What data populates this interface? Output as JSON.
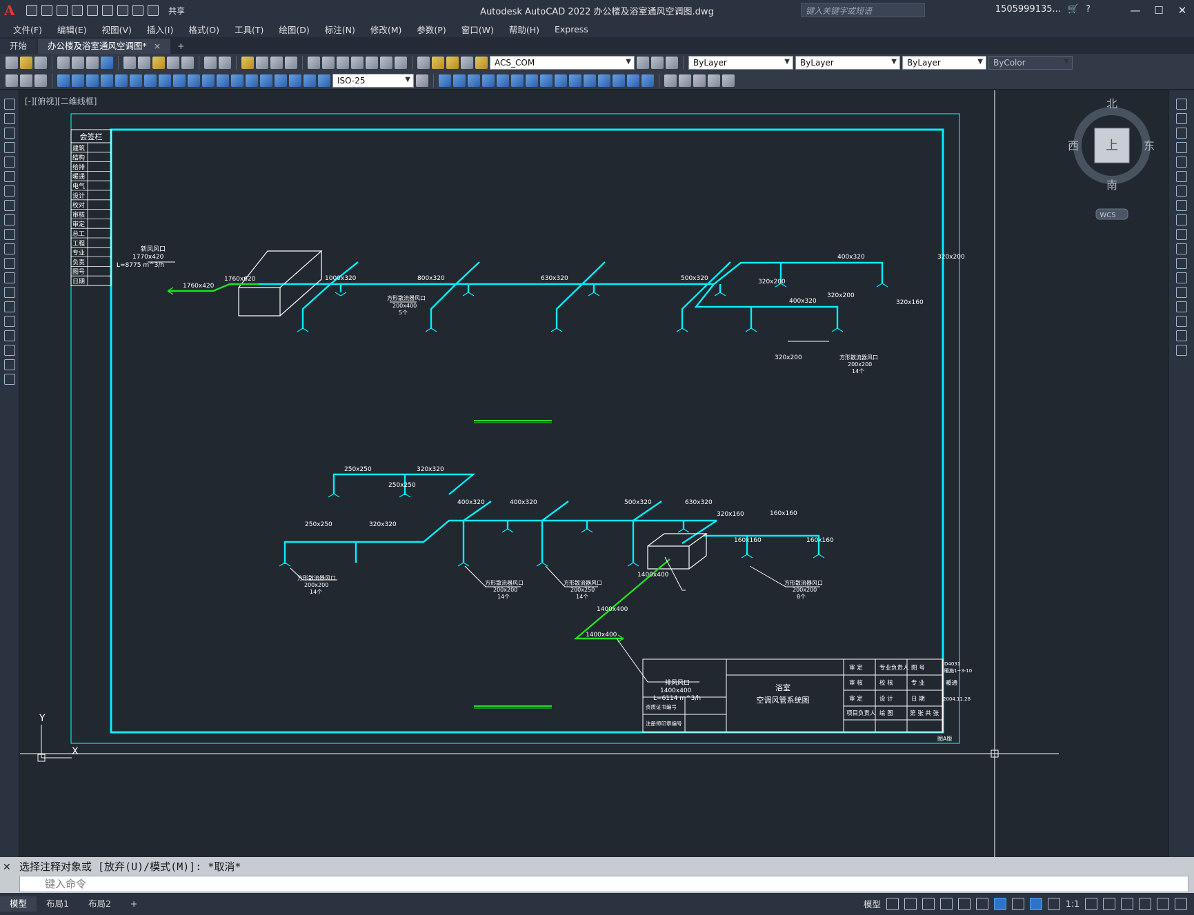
{
  "app": {
    "logo": "A",
    "title": "Autodesk AutoCAD 2022    办公楼及浴室通风空调图.dwg",
    "share": "共享",
    "search_placeholder": "键入关键字或短语",
    "user": "1505999135...",
    "help": "?"
  },
  "menu": [
    "文件(F)",
    "编辑(E)",
    "视图(V)",
    "插入(I)",
    "格式(O)",
    "工具(T)",
    "绘图(D)",
    "标注(N)",
    "修改(M)",
    "参数(P)",
    "窗口(W)",
    "帮助(H)",
    "Express"
  ],
  "tabs": {
    "start": "开始",
    "active": "办公楼及浴室通风空调图*",
    "close": "×",
    "add": "+"
  },
  "toolbar": {
    "layer": "ACS_COM",
    "color": "ByLayer",
    "linetype": "ByLayer",
    "lineweight": "ByLayer",
    "plotstyle": "ByColor",
    "dimstyle": "ISO-25"
  },
  "viewport_label": "[-][俯视][二维线框]",
  "viewcube": {
    "north": "北",
    "south": "南",
    "east": "东",
    "west": "西",
    "top": "上",
    "wcs": "WCS"
  },
  "ucs": {
    "x": "X",
    "y": "Y"
  },
  "sign_table": {
    "title": "会签栏",
    "rows": [
      "建筑",
      "结构",
      "给排",
      "暖通",
      "电气",
      "设计",
      "校对",
      "审核",
      "审定",
      "总工",
      "工程",
      "专业",
      "负责",
      "图号",
      "日期"
    ]
  },
  "drawing": {
    "upper_labels": [
      "新风风口",
      "1770x420",
      "L=8775 m^3/h",
      "1760x420",
      "1760x620",
      "1000x320",
      "800x320",
      "630x320",
      "500x320",
      "400x320",
      "320x200",
      "320x160",
      "400x320",
      "320x200",
      "320x200",
      "320x200",
      "方形散流器风口",
      "200x400",
      "5个",
      "方形散流器风口",
      "200x200",
      "14个"
    ],
    "lower_labels": [
      "250x250",
      "320x320",
      "400x320",
      "400x320",
      "500x320",
      "630x320",
      "320x160",
      "160x160",
      "160x160",
      "160x160",
      "250x250",
      "320x320",
      "250x250",
      "方形散流器风口",
      "200x200",
      "14个",
      "方形散流器风口",
      "200x200",
      "14个",
      "方形散流器风口",
      "200x250",
      "14个",
      "方形散流器风口",
      "200x200",
      "8个",
      "1400x400",
      "1400x400",
      "1400x400",
      "排风风口",
      "1400x400",
      "L=6114 m^3/h"
    ]
  },
  "title_block": {
    "project": "浴室",
    "drawing_name": "空调风管系统图",
    "cells": [
      "审 定",
      "专业负责人",
      "图 号",
      "D4031",
      "暖施1~3-10",
      "审 核",
      "校 核",
      "专 业",
      "暖通",
      "审 定",
      "设 计",
      "日 期",
      "2004.11.28",
      "项目负责人",
      "绘 图",
      "第  张 共  张",
      "资质证书编号",
      "注册师印章编号"
    ],
    "footer": "图A版"
  },
  "command": {
    "history": "选择注释对象或 [放弃(U)/模式(M)]: *取消*",
    "placeholder": "键入命令"
  },
  "status": {
    "tabs": [
      "模型",
      "布局1",
      "布局2"
    ],
    "model": "模型",
    "scale": "1:1"
  }
}
